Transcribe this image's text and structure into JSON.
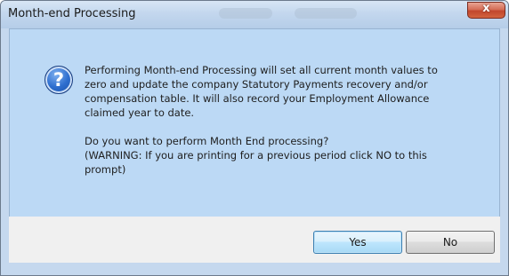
{
  "dialog": {
    "title": "Month-end Processing",
    "close_label": "x",
    "icon": "question-icon",
    "message": {
      "paragraph1_lines": [
        "Performing Month-end Processing will set all current month values to",
        "zero and update the company Statutory Payments recovery and/or",
        "compensation table. It will also record your Employment Allowance",
        "claimed year to date."
      ],
      "paragraph2_lines": [
        "Do you want to perform Month End processing?",
        "(WARNING: If you are printing for a previous period click NO to this",
        "prompt)"
      ]
    },
    "buttons": {
      "yes_label": "Yes",
      "no_label": "No",
      "default": "yes"
    }
  },
  "colors": {
    "content_background": "#bcd9f5",
    "footer_background": "#f0f0f0",
    "close_button": "#c2472d",
    "icon_blue": "#2f6fcf"
  }
}
